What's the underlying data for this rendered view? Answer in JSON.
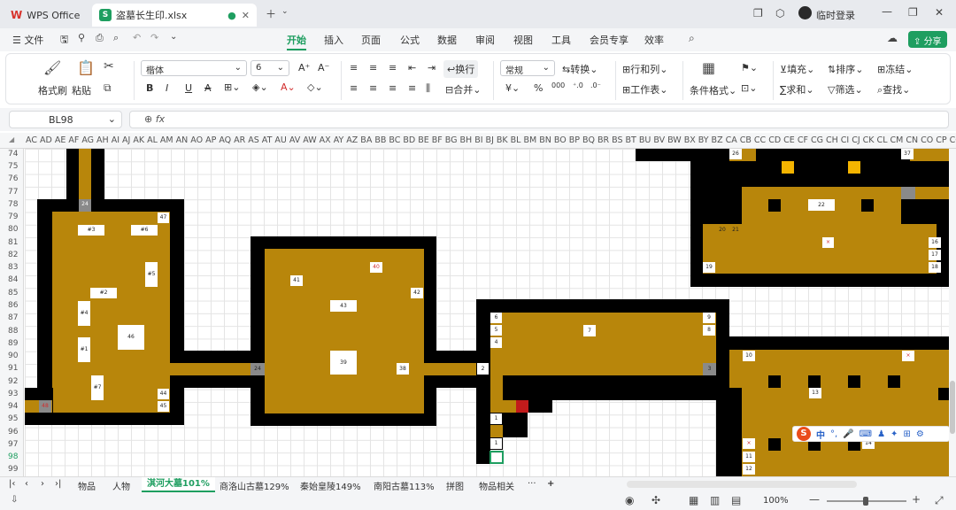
{
  "titlebar": {
    "home_tab": "WPS Office",
    "file_tab": "盗墓长生印.xlsx",
    "login": "临时登录"
  },
  "menu": {
    "file": "文件",
    "items": [
      "开始",
      "插入",
      "页面",
      "公式",
      "数据",
      "审阅",
      "视图",
      "工具",
      "会员专享",
      "效率"
    ],
    "active": "开始",
    "share": "分享"
  },
  "ribbon": {
    "format_painter": "格式刷",
    "paste": "粘贴",
    "font_name": "楷体",
    "font_size": "6",
    "wrap": "换行",
    "number_format": "常规",
    "convert": "转换",
    "merge": "合并",
    "row_col": "行和列",
    "worksheet": "工作表",
    "cond_format": "条件格式",
    "fill": "填充",
    "sort": "排序",
    "freeze": "冻结",
    "sum": "求和",
    "filter": "筛选",
    "find": "查找"
  },
  "formula_bar": {
    "name_box": "BL98",
    "fx": "fx",
    "value": ""
  },
  "columns": "AC AD AE AF AG AH  AI  AJ AK AL AM AN AO AP AQ AR AS AT AU AV AW AX AY  AZ BA BB BC BD  BE  BF BG BH  BI  BJ BK BL BM BN BO BP BQ BR  BS  BT  BU BV BW BX BY  BZ CA CB CC CD CE CF CG CH  CI  CJ CK CL CM CN CO CP CQ CR CS",
  "rows": [
    "74",
    "75",
    "76",
    "77",
    "78",
    "79",
    "80",
    "81",
    "82",
    "83",
    "84",
    "85",
    "86",
    "87",
    "88",
    "89",
    "90",
    "91",
    "92",
    "93",
    "94",
    "95",
    "96",
    "97",
    "98",
    "99"
  ],
  "active_cell_row": "98",
  "map_labels": {
    "l24a": "24",
    "l47": "47",
    "l48": "48",
    "l3": "#3",
    "l6": "#6",
    "l5": "#5",
    "l2": "#2",
    "l4": "#4",
    "l46": "46",
    "l1": "#1",
    "l7": "#7",
    "l44": "44",
    "l45": "45",
    "l24b": "24",
    "l41": "41",
    "l40": "40",
    "l42": "42",
    "l43": "43",
    "l39": "39",
    "l38": "38",
    "l2b": "2",
    "l6b": "6",
    "l5b": "5",
    "l4b": "4",
    "l7b": "7",
    "l9": "9",
    "l8": "8",
    "l3b": "3",
    "l1b": "1",
    "l1c": "1",
    "l26": "26",
    "l37": "37",
    "l22": "22",
    "l20": "20",
    "l21": "21",
    "lx": "×",
    "l19": "19",
    "l16": "16",
    "l17": "17",
    "l18": "18",
    "l10": "10",
    "lx2": "×",
    "l13": "13",
    "l11": "11",
    "l12": "12",
    "l14": "14",
    "lx3": "×"
  },
  "sheets": [
    "物品",
    "人物",
    "淇河大墓101%",
    "商洛山古墓129%",
    "秦始皇陵149%",
    "南阳古墓113%",
    "拼图",
    "物品相关",
    "···"
  ],
  "active_sheet": "淇河大墓101%",
  "status": {
    "zoom": "100%"
  },
  "ime": {
    "mode": "中"
  },
  "colors": {
    "gold": "#b8860b",
    "wall": "#000000",
    "accent": "#1e9e60"
  }
}
